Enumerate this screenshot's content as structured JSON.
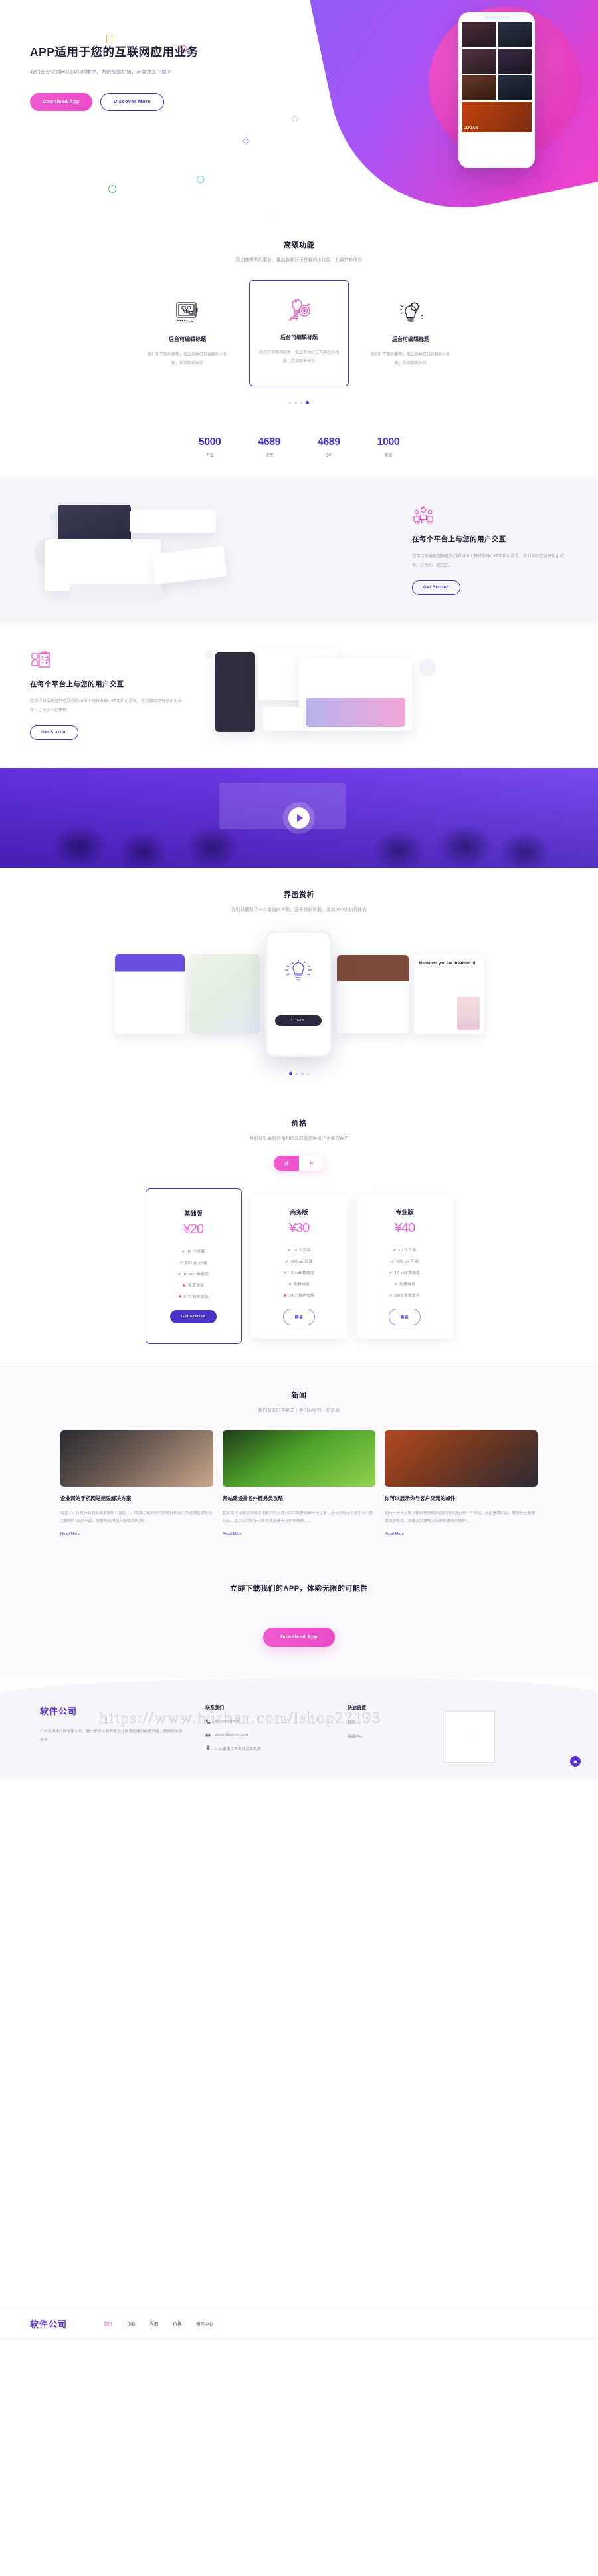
{
  "nav": {
    "logo": "软件公司",
    "items": [
      {
        "label": "首页",
        "active": true
      },
      {
        "label": "功能",
        "active": false
      },
      {
        "label": "界面",
        "active": false
      },
      {
        "label": "价格",
        "active": false
      },
      {
        "label": "新闻中心",
        "active": false
      }
    ]
  },
  "hero": {
    "title": "APP适用于您的互联网应用业务",
    "subtitle": "我们有专业的团队24小时维护，为您保驾护航，赶紧快来下载吧",
    "primary_button": "Download App",
    "secondary_button": "Discover More",
    "phone_badge": "LOGAN"
  },
  "features": {
    "title": "高级功能",
    "subtitle": "我们在不断的更新，推出各种好玩有趣的小功能，欢迎前来体验",
    "cards": [
      {
        "title": "后台可编辑标题",
        "desc": "我们在不断的更新，推出各种好玩有趣的小功能，欢迎前来体验",
        "icon": "tablet-sketch-icon"
      },
      {
        "title": "后台可编辑标题",
        "desc": "我们在不断的更新，推出各种好玩有趣的小功能，欢迎前来体验",
        "icon": "bulb-target-icon"
      },
      {
        "title": "后台可编辑标题",
        "desc": "我们在不断的更新，推出各种好玩有趣的小功能，欢迎前来体验",
        "icon": "bulb-gear-icon"
      }
    ],
    "dots": 4,
    "active_dot": 4
  },
  "stats": [
    {
      "value": "5000",
      "label": "下载"
    },
    {
      "value": "4689",
      "label": "点赞"
    },
    {
      "value": "4689",
      "label": "5星"
    },
    {
      "value": "1000",
      "label": "奖品"
    }
  ],
  "split1": {
    "title": "在每个平台上与您的用户交互",
    "desc": "您可以畅通无阻的在我们的APP上玩转各种小应用和小游戏，我们期待您分享给小伙伴，让他们一起来玩。",
    "button": "Get Started",
    "icon": "people-group-icon"
  },
  "split2": {
    "title": "在每个平台上与您的用户交互",
    "desc": "您可以畅通无阻的在我们的APP上玩转各种小应用和小游戏，我们期待您分享给小伙伴，让他们一起来玩。",
    "button": "Get Started",
    "icon": "clipboard-check-icon"
  },
  "video": {
    "play_icon": "play-icon"
  },
  "screens": {
    "title": "界面赏析",
    "subtitle": "我们只截取了一小部分的界面，更多精彩界面，请到APP内自行体验",
    "right_caption": "Mansions you are dreamed of",
    "phone_button": "LOGIN",
    "dots": 4,
    "active_dot": 1
  },
  "pricing": {
    "title": "价格",
    "subtitle": "我们以低廉的价格和优质的服务吸引了大量的客户",
    "toggle": {
      "monthly": "月",
      "yearly": "年",
      "selected": "月"
    },
    "plans": [
      {
        "name": "基础版",
        "price": "¥20",
        "featured": true,
        "button": "Get Started",
        "features": [
          {
            "text": "10 个页面",
            "included": true
          },
          {
            "text": "500 gb 存储",
            "included": true
          },
          {
            "text": "10 sdd 数据库",
            "included": true
          },
          {
            "text": "免费域名",
            "included": false
          },
          {
            "text": "24/7 技术支持",
            "included": false
          }
        ]
      },
      {
        "name": "商务版",
        "price": "¥30",
        "featured": false,
        "button": "购买",
        "features": [
          {
            "text": "10 个页面",
            "included": true
          },
          {
            "text": "500 gb 存储",
            "included": true
          },
          {
            "text": "10 sdd 数据库",
            "included": true
          },
          {
            "text": "免费域名",
            "included": true
          },
          {
            "text": "24/7 技术支持",
            "included": false
          }
        ]
      },
      {
        "name": "专业版",
        "price": "¥40",
        "featured": false,
        "button": "购买",
        "features": [
          {
            "text": "10 个页面",
            "included": true
          },
          {
            "text": "500 gb 存储",
            "included": true
          },
          {
            "text": "10 sdd 数据库",
            "included": true
          },
          {
            "text": "免费域名",
            "included": true
          },
          {
            "text": "24/7 技术支持",
            "included": true
          }
        ]
      }
    ]
  },
  "news": {
    "title": "新闻",
    "subtitle": "我们将实时更新关于我们APP的一切信息",
    "read_more": "Read More",
    "cards": [
      {
        "title": "企业网站手机网站建设解决方案",
        "desc": "错过了，传统行业的高速发展期！错过了，PC端互联网时代的绝佳机会！你还想错过移动互联网？2014年起，百度移动搜索开始取消PC网…"
      },
      {
        "title": "网站建设排名外链另类攻略",
        "desc": "其实每个接触过网络优化推广的人对于SEO和外链都十分了解，还有外链专员这个专门的行业。其实SEO对于门外客来说是十分的神秘的。…"
      },
      {
        "title": "你可以展示你与客户交流的邮件",
        "desc": "如何一步步从零开始制作你的网站如果你决定建一个网站。无论是做产品、做服务还是做其他的东西，你都会需要找人来帮你做技术维护…"
      }
    ]
  },
  "cta": {
    "title": "立即下载我们的APP，体验无限的可能性",
    "button": "Download App"
  },
  "footer": {
    "logo": "软件公司",
    "desc": "广州某网络科技有限公司，是一家专业服务于企业信息化建设的提供商，是网络信息技术",
    "contact": {
      "heading": "联系我们",
      "phone": "400-888-8888",
      "email": "admin@admin.com",
      "address": "江苏省南京市玄武区玄武湖"
    },
    "links": {
      "heading": "快速链接",
      "items": [
        "首页",
        "新闻中心"
      ]
    },
    "qr_label": "",
    "watermark": "https://www.huzhan.com/ishop27193",
    "backtop_icon": "chevron-up-icon"
  },
  "colors": {
    "purple": "#4a33c9",
    "pink": "#f05bd0",
    "logo_purple": "#5b32d6",
    "green_tick": "#2fb574",
    "red_cross": "#e0443f"
  }
}
